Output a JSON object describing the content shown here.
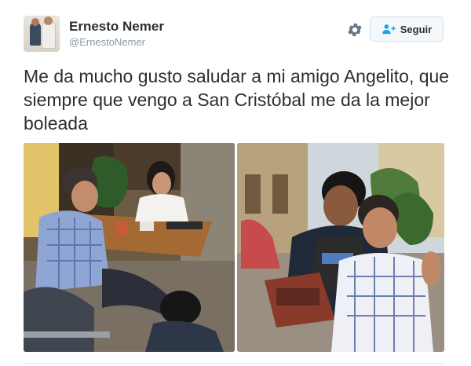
{
  "tweet": {
    "author_name": "Ernesto Nemer",
    "author_handle": "@ErnestoNemer",
    "text": "Me da mucho gusto saludar a mi amigo Angelito, que siempre que vengo a San Cristóbal me da la mejor boleada"
  },
  "actions": {
    "follow_label": "Seguir",
    "follow_icon": "add-user-icon",
    "settings_icon": "gear-icon"
  },
  "colors": {
    "text": "#292f33",
    "secondary": "#8899a6",
    "accent": "#1da1f2",
    "button_bg": "#f5f8fa"
  }
}
